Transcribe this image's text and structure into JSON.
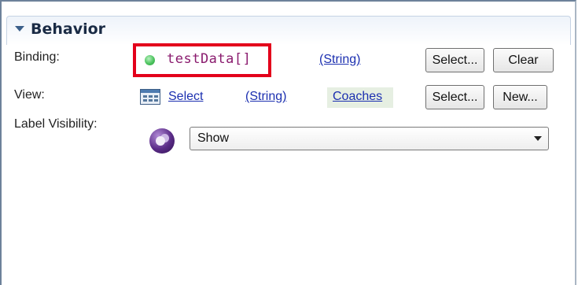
{
  "section": {
    "title": "Behavior",
    "toggle_icon": "chevron-down-icon"
  },
  "binding": {
    "label": "Binding:",
    "variable": "testData[]",
    "status_icon": "green-dot-icon",
    "type_link": "(String)",
    "select_button": "Select...",
    "clear_button": "Clear"
  },
  "view": {
    "label": "View:",
    "icon": "view-table-icon",
    "select_link": "Select",
    "type_link": "(String)",
    "coaches_link": "Coaches",
    "select_button": "Select...",
    "new_button": "New..."
  },
  "label_visibility": {
    "label": "Label Visibility:",
    "icon": "visibility-icon",
    "selected_value": "Show"
  },
  "colors": {
    "highlight": "#e3001b",
    "link": "#1b2fb0",
    "binding_variable": "#8a1b6e"
  }
}
